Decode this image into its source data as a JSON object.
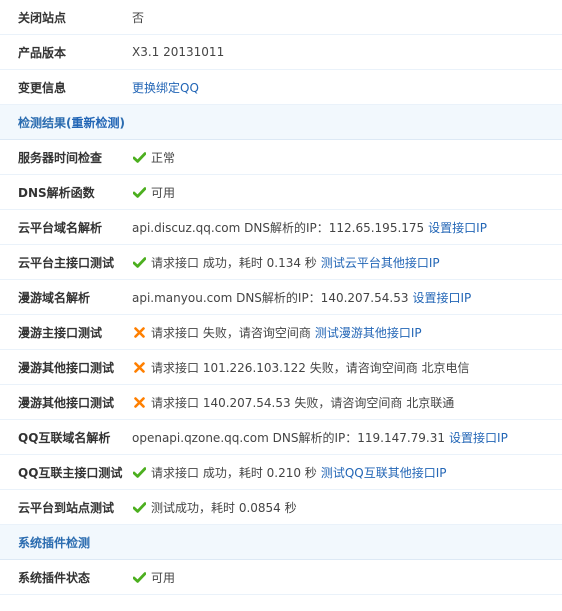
{
  "rows": {
    "close_site": {
      "label": "关闭站点",
      "value": "否"
    },
    "product_version": {
      "label": "产品版本",
      "value": "X3.1 20131011"
    },
    "change_info": {
      "label": "变更信息",
      "link": "更换绑定QQ"
    },
    "detect_section": {
      "title_prefix": "检测结果(",
      "title_link": "重新检测",
      "title_suffix": ")"
    },
    "server_time": {
      "label": "服务器时间检查",
      "status": "正常"
    },
    "dns_func": {
      "label": "DNS解析函数",
      "status": "可用"
    },
    "cloud_domain": {
      "label": "云平台域名解析",
      "text": "api.discuz.qq.com DNS解析的IP：112.65.195.175",
      "link": "设置接口IP"
    },
    "cloud_main": {
      "label": "云平台主接口测试",
      "text": "请求接口 成功，耗时 0.134 秒",
      "link": "测试云平台其他接口IP"
    },
    "manyou_domain": {
      "label": "漫游域名解析",
      "text": "api.manyou.com DNS解析的IP：140.207.54.53",
      "link": "设置接口IP"
    },
    "manyou_main": {
      "label": "漫游主接口测试",
      "text": "请求接口 失败，请咨询空间商",
      "link": "测试漫游其他接口IP"
    },
    "manyou_other1": {
      "label": "漫游其他接口测试",
      "text": "请求接口 101.226.103.122 失败，请咨询空间商 北京电信"
    },
    "manyou_other2": {
      "label": "漫游其他接口测试",
      "text": "请求接口 140.207.54.53 失败，请咨询空间商 北京联通"
    },
    "qq_domain": {
      "label": "QQ互联域名解析",
      "text": "openapi.qzone.qq.com DNS解析的IP：119.147.79.31",
      "link": "设置接口IP"
    },
    "qq_main": {
      "label": "QQ互联主接口测试",
      "text": "请求接口 成功，耗时 0.210 秒",
      "link": "测试QQ互联其他接口IP"
    },
    "cloud_site": {
      "label": "云平台到站点测试",
      "text": "测试成功，耗时 0.0854 秒"
    },
    "plugin_section": {
      "title": "系统插件检测"
    },
    "plugin_status": {
      "label": "系统插件状态",
      "status": "可用"
    }
  },
  "colors": {
    "success": "#4caf1f",
    "failure": "#ff7f00",
    "link": "#2366b6",
    "section_bg": "#f2f8fd"
  },
  "icons": {
    "success": "check-icon",
    "failure": "cross-icon"
  }
}
